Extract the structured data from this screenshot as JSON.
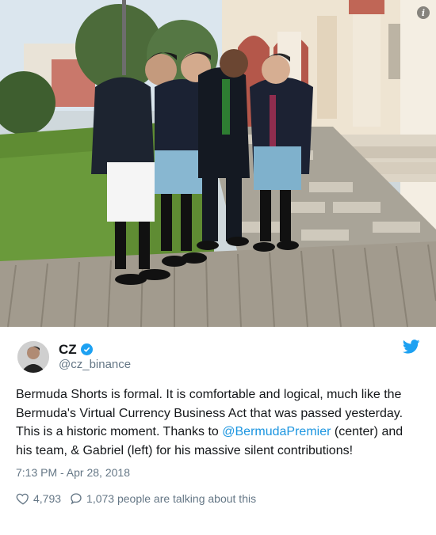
{
  "tweet": {
    "display_name": "CZ",
    "handle": "@cz_binance",
    "text_before_mention": "Bermuda Shorts is formal. It is comfortable and logical, much like the Bermuda's Virtual Currency Business Act that was passed yesterday. This is a historic moment. Thanks to ",
    "mention": "@BermudaPremier",
    "text_after_mention": " (center) and his team, & Gabriel (left) for his massive silent contributions!",
    "timestamp": "7:13 PM - Apr 28, 2018",
    "likes": "4,793",
    "conversation": "1,073 people are talking about this"
  },
  "icons": {
    "verified": "verified-badge-icon",
    "twitter": "twitter-bird-icon",
    "like": "heart-icon",
    "reply": "speech-bubble-icon",
    "info": "info-icon"
  },
  "colors": {
    "twitter_blue": "#1da1f2",
    "link_blue": "#1b95e0",
    "secondary_text": "#657786",
    "primary_text": "#14171a"
  }
}
